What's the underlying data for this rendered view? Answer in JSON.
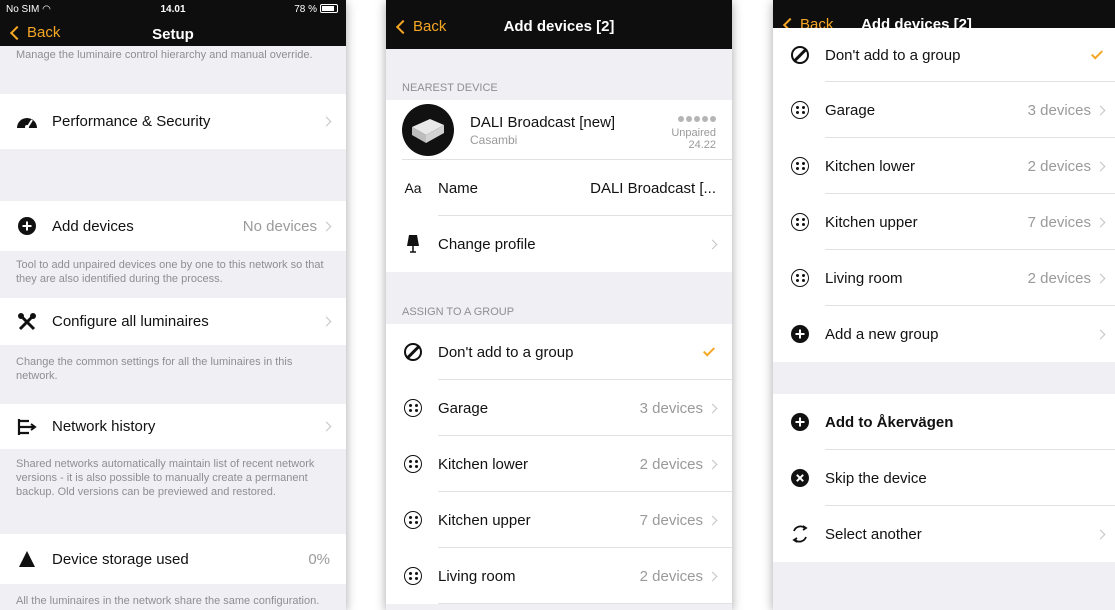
{
  "colors": {
    "accent": "#f5a623",
    "header": "#0e0e0e",
    "background": "#efeff4"
  },
  "screen1": {
    "status": {
      "carrier": "No SIM",
      "time": "14.01",
      "battery": "78 %"
    },
    "back_label": "Back",
    "title": "Setup",
    "top_desc": "Manage the luminaire control hierarchy and manual override.",
    "performance": {
      "label": "Performance & Security",
      "icon": "speedometer-icon"
    },
    "add_devices": {
      "label": "Add devices",
      "value": "No devices",
      "icon": "plus-circle-icon",
      "desc": "Tool to add unpaired devices one by one to this network so that they are also identified during the process."
    },
    "configure": {
      "label": "Configure all luminaires",
      "icon": "tools-icon",
      "desc": "Change the common settings for all the luminaires in this network."
    },
    "history": {
      "label": "Network history",
      "icon": "history-icon",
      "desc": "Shared networks automatically maintain list of recent network versions - it is also possible to manually create a permanent backup. Old versions can be previewed and restored."
    },
    "storage": {
      "label": "Device storage used",
      "value": "0%",
      "icon": "storage-icon",
      "desc": "All the luminaires in the network share the same configuration. Adding more luminaires, scenes and"
    }
  },
  "screen2": {
    "back_label": "Back",
    "title": "Add devices [2]",
    "nearest_header": "NEAREST DEVICE",
    "device": {
      "name": "DALI Broadcast [new]",
      "vendor": "Casambi",
      "state": "Unpaired",
      "version": "24.22"
    },
    "name_row": {
      "prefix": "Aa",
      "label": "Name",
      "value": "DALI Broadcast [..."
    },
    "profile_row": {
      "label": "Change profile",
      "icon": "lamp-icon"
    },
    "assign_header": "ASSIGN TO A GROUP",
    "groups": [
      {
        "label": "Don't add to a group",
        "value": "",
        "checked": true
      },
      {
        "label": "Garage",
        "value": "3 devices"
      },
      {
        "label": "Kitchen lower",
        "value": "2 devices"
      },
      {
        "label": "Kitchen upper",
        "value": "7 devices"
      },
      {
        "label": "Living room",
        "value": "2 devices"
      }
    ]
  },
  "screen3": {
    "back_label": "Back",
    "title": "Add devices [2]",
    "groups": [
      {
        "label": "Don't add to a group",
        "value": "",
        "checked": true
      },
      {
        "label": "Garage",
        "value": "3 devices"
      },
      {
        "label": "Kitchen lower",
        "value": "2 devices"
      },
      {
        "label": "Kitchen upper",
        "value": "7 devices"
      },
      {
        "label": "Living room",
        "value": "2 devices"
      }
    ],
    "add_group": "Add a new group",
    "add_to": "Add to Åkervägen",
    "skip": "Skip the device",
    "select_another": "Select another"
  }
}
